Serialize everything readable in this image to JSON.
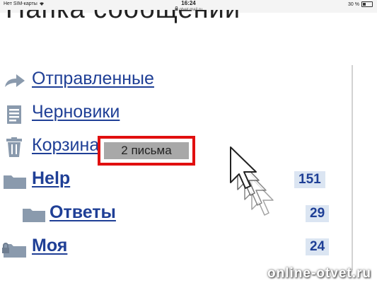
{
  "status_bar": {
    "carrier": "Нет SIM-карты",
    "wifi_icon": "wifi-icon",
    "time": "16:24",
    "url": "otvet.mail.ru",
    "lock_icon": "lock-icon",
    "battery": "30 %",
    "battery_icon": "battery-icon"
  },
  "heading": "Папка сообщений",
  "folders": [
    {
      "label": "Отправленные",
      "icon": "sent-arrow-icon"
    },
    {
      "label": "Черновики",
      "icon": "drafts-icon"
    },
    {
      "label": "Корзина",
      "icon": "trash-icon"
    },
    {
      "label": "Help",
      "icon": "folder-icon",
      "count": "151"
    },
    {
      "label": "Ответы",
      "icon": "folder-icon",
      "count": "29"
    },
    {
      "label": "Моя",
      "icon": "locked-folder-icon",
      "count": "24"
    }
  ],
  "tooltip": {
    "text": "2 письма"
  },
  "cursor_icon": "mouse-pointer-icon",
  "watermark": "online-otvet.ru",
  "colors": {
    "link": "#1f3f96",
    "badge_bg": "#dbe5f2",
    "tooltip_border": "#e10f0f",
    "tooltip_bg": "#a8a8a8",
    "icon_gray": "#8a9aad"
  }
}
